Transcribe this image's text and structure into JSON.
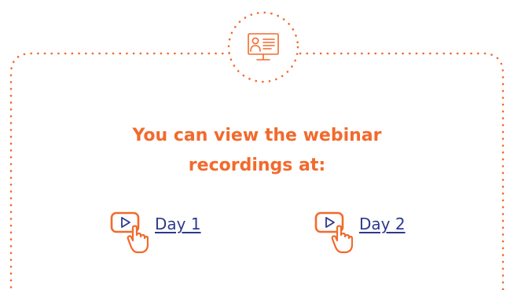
{
  "heading": {
    "line1": "You can view the webinar",
    "line2": "recordings at:"
  },
  "links": [
    {
      "label": "Day 1",
      "icon": "play-click-icon"
    },
    {
      "label": "Day 2",
      "icon": "play-click-icon"
    }
  ],
  "badge": {
    "icon": "webinar-monitor-icon"
  },
  "colors": {
    "accent": "#f26a2c",
    "link": "#2e3a8c",
    "background": "#ffffff"
  }
}
